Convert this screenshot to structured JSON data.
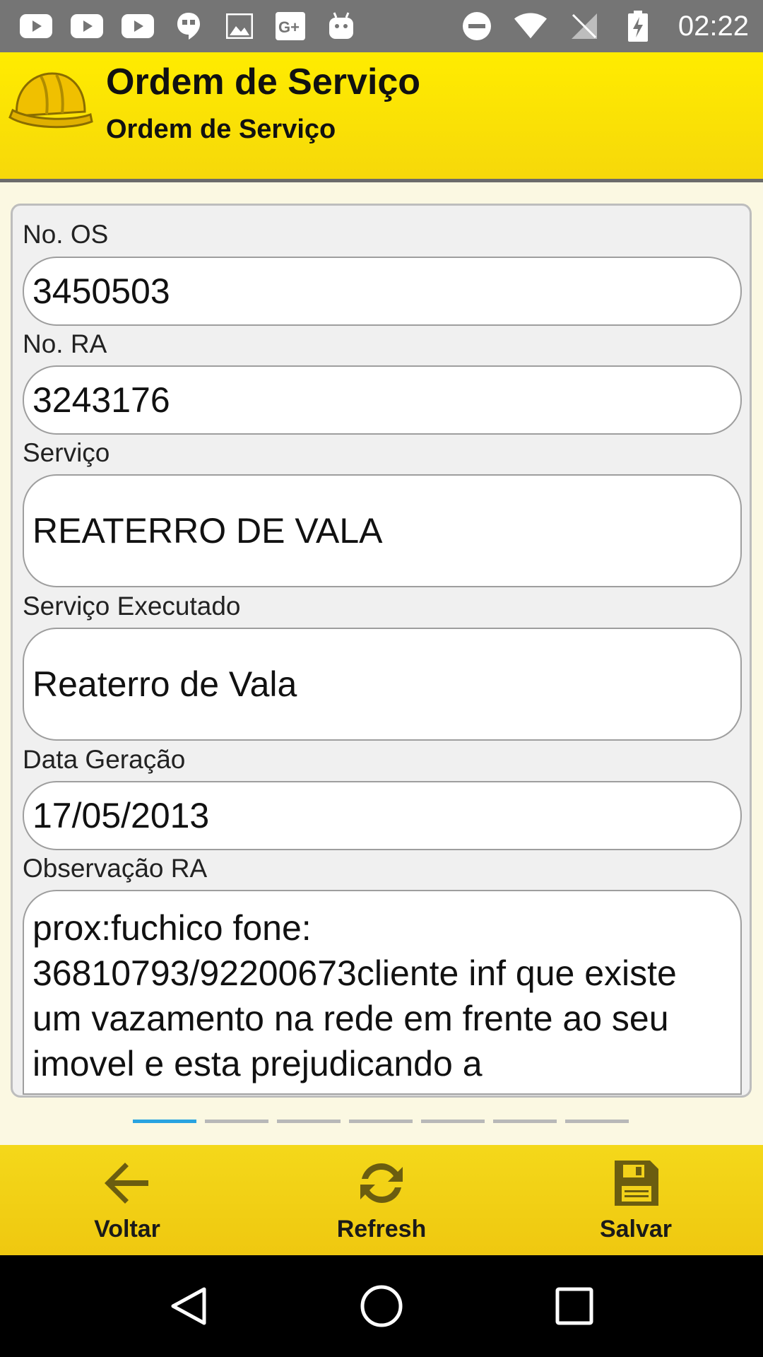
{
  "status_bar": {
    "time": "02:22",
    "left_icons": [
      "youtube-icon",
      "youtube-icon",
      "youtube-icon",
      "hangouts-icon",
      "image-icon",
      "google-plus-icon",
      "android-icon"
    ],
    "right_icons": [
      "do-not-disturb-icon",
      "wifi-icon",
      "no-signal-icon",
      "battery-charging-icon"
    ]
  },
  "header": {
    "title": "Ordem de Serviço",
    "subtitle": "Ordem de Serviço",
    "logo_icon": "hard-hat-icon"
  },
  "form": {
    "os_label": "No. OS",
    "os_value": "3450503",
    "ra_label": "No. RA",
    "ra_value": "3243176",
    "servico_label": "Serviço",
    "servico_value": "REATERRO DE VALA",
    "executado_label": "Serviço Executado",
    "executado_value": "Reaterro de Vala",
    "data_label": "Data Geração",
    "data_value": "17/05/2013",
    "obs_label": "Observação RA",
    "obs_value": "prox:fuchico fone: 36810793/92200673cliente inf que existe um vazamento na rede em frente ao seu imovel e esta prejudicando a"
  },
  "pager": {
    "pages": 7,
    "active": 0,
    "active_color": "#29a3e0"
  },
  "actions": {
    "back_label": "Voltar",
    "refresh_label": "Refresh",
    "save_label": "Salvar"
  },
  "colors": {
    "header_yellow": "#ffec00",
    "action_yellow": "#f4d81a",
    "status_gray": "#757575"
  }
}
